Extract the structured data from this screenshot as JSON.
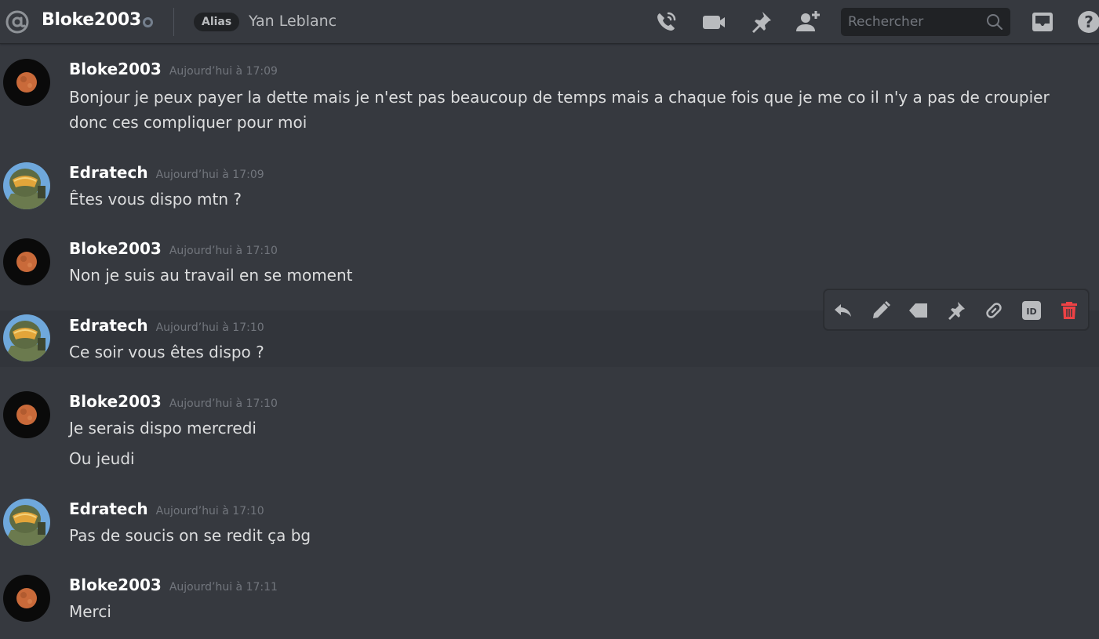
{
  "topbar": {
    "channel_name": "Bloke2003",
    "alias_badge": "Alias",
    "alias_name": "Yan Leblanc",
    "search_placeholder": "Rechercher",
    "icons": [
      "at-icon",
      "phone-call-icon",
      "video-call-icon",
      "pin-icon",
      "add-friend-icon",
      "search-icon",
      "inbox-icon",
      "help-icon"
    ]
  },
  "messages": [
    {
      "author": "Bloke2003",
      "timestamp": "Aujourd’hui à 17:09",
      "avatar": "moon",
      "lines": [
        "Bonjour je peux payer la dette mais je n'est pas beaucoup de temps mais a chaque fois que je me co il n'y a pas de croupier",
        "donc ces compliquer pour moi"
      ]
    },
    {
      "author": "Edratech",
      "timestamp": "Aujourd’hui à 17:09",
      "avatar": "spartan",
      "lines": [
        "Êtes vous dispo mtn ?"
      ]
    },
    {
      "author": "Bloke2003",
      "timestamp": "Aujourd’hui à 17:10",
      "avatar": "moon",
      "lines": [
        "Non je suis au travail en se moment"
      ]
    },
    {
      "author": "Edratech",
      "timestamp": "Aujourd’hui à 17:10",
      "avatar": "spartan",
      "lines": [
        "Ce soir vous êtes dispo ?"
      ]
    },
    {
      "author": "Bloke2003",
      "timestamp": "Aujourd’hui à 17:10",
      "avatar": "moon",
      "lines": [
        "Je serais dispo mercredi",
        "Ou jeudi"
      ]
    },
    {
      "author": "Edratech",
      "timestamp": "Aujourd’hui à 17:10",
      "avatar": "spartan",
      "lines": [
        "Pas de soucis on se redit ça bg"
      ]
    },
    {
      "author": "Bloke2003",
      "timestamp": "Aujourd’hui à 17:11",
      "avatar": "moon",
      "lines": [
        "Merci"
      ]
    }
  ],
  "action_bar": {
    "icons": [
      "reply-icon",
      "edit-icon",
      "tag-icon",
      "pin-icon",
      "link-icon",
      "id-icon",
      "delete-icon"
    ],
    "colors": {
      "icon": "#b9bbbe",
      "delete": "#ed4245"
    }
  },
  "colors": {
    "background": "#36393f",
    "username": "#ffffff",
    "text": "#dcddde",
    "timestamp": "#72767d",
    "search_bg": "#202225"
  }
}
